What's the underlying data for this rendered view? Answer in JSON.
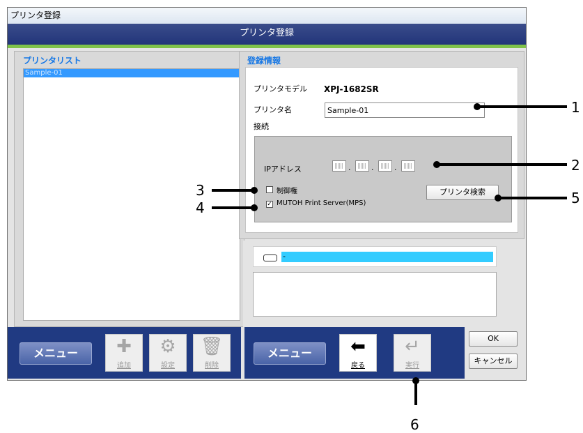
{
  "window": {
    "title": "プリンタ登録",
    "header": "プリンタ登録"
  },
  "printer_list": {
    "title": "プリンタリスト",
    "items": [
      "Sample-01"
    ]
  },
  "registration": {
    "title": "登録情報",
    "model_label": "プリンタモデル",
    "model_value": "XPJ-1682SR",
    "name_label": "プリンタ名",
    "name_value": "Sample-01",
    "connection_label": "接続",
    "ip_label": "IPアドレス",
    "ip_sep": ".",
    "control_label": "制御権",
    "control_checked": false,
    "mps_label": "MUTOH Print Server(MPS)",
    "mps_checked": true,
    "search_button": "プリンタ検索"
  },
  "status": {
    "text": "-"
  },
  "left_toolbar": {
    "menu": "メニュー",
    "add": "追加",
    "settings": "設定",
    "delete": "削除"
  },
  "right_toolbar": {
    "menu": "メニュー",
    "back": "戻る",
    "execute": "実行",
    "ok": "OK",
    "cancel": "キャンセル"
  },
  "callouts": [
    "1",
    "2",
    "3",
    "4",
    "5",
    "6"
  ],
  "colors": {
    "header": "#22357a",
    "accent_green": "#7fc24a",
    "selection": "#3399ff",
    "panel_title": "#1677e5",
    "status_bar": "#33ccff"
  }
}
